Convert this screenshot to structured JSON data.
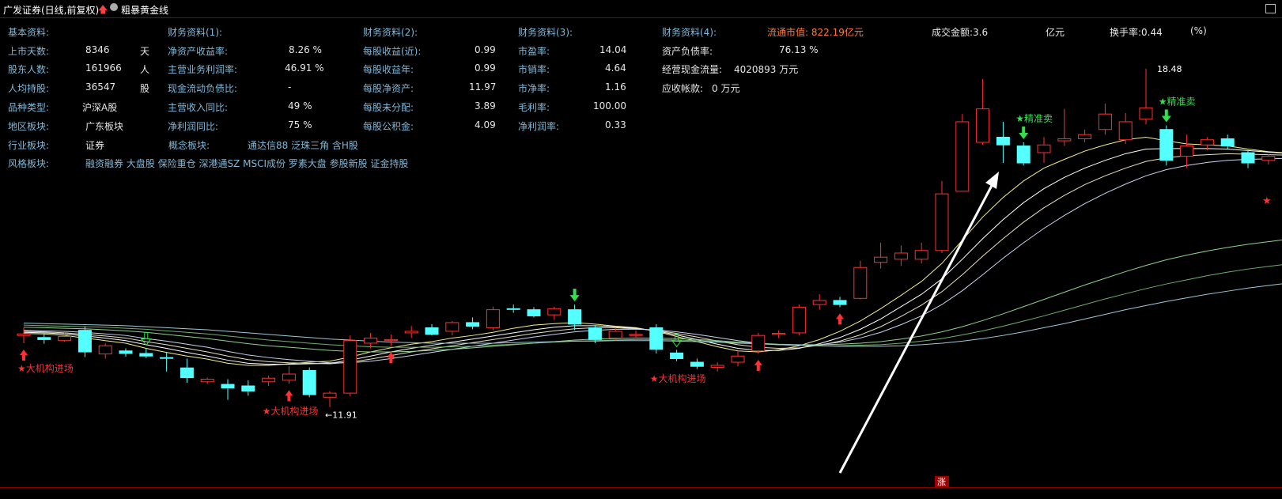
{
  "header": {
    "stock_title": "广发证券(日线,前复权)",
    "indicator_name": "粗暴黄金线",
    "window_icon": "window-restore-icon"
  },
  "fundamentals": {
    "basic": {
      "title": "基本资料:",
      "rows": [
        {
          "label": "上市天数:",
          "value": "8346",
          "unit": "天"
        },
        {
          "label": "股东人数:",
          "value": "161966",
          "unit": "人"
        },
        {
          "label": "人均持股:",
          "value": "36547",
          "unit": "股"
        },
        {
          "label": "品种类型:",
          "value": "沪深A股",
          "unit": ""
        },
        {
          "label": "地区板块:",
          "value": "广东板块",
          "unit": ""
        },
        {
          "label": "行业板块:",
          "value": "证券",
          "unit": ""
        },
        {
          "label": "风格板块:",
          "value": "融资融券 大盘股 保险重仓 深港通SZ MSCI成份 罗素大盘 参股新股 证金持股",
          "unit": ""
        }
      ],
      "concept_label": "概念板块:",
      "concept_value": "通达信88 泛珠三角 含H股"
    },
    "fin1": {
      "title": "财务资料(1):",
      "rows": [
        {
          "label": "净资产收益率:",
          "value": "8.26 %"
        },
        {
          "label": "主营业务利润率:",
          "value": "46.91 %"
        },
        {
          "label": "现金流动负债比:",
          "value": "-"
        },
        {
          "label": "主营收入同比:",
          "value": "49 %"
        },
        {
          "label": "净利润同比:",
          "value": "75 %"
        }
      ]
    },
    "fin2": {
      "title": "财务资料(2):",
      "rows": [
        {
          "label": "每股收益(近):",
          "value": "0.99"
        },
        {
          "label": "每股收益年:",
          "value": "0.99"
        },
        {
          "label": "每股净资产:",
          "value": "11.97"
        },
        {
          "label": "每股未分配:",
          "value": "3.89"
        },
        {
          "label": "每股公积金:",
          "value": "4.09"
        }
      ]
    },
    "fin3": {
      "title": "财务资料(3):",
      "rows": [
        {
          "label": "市盈率:",
          "value": "14.04"
        },
        {
          "label": "市销率:",
          "value": "4.64"
        },
        {
          "label": "市净率:",
          "value": "1.16"
        },
        {
          "label": "毛利率:",
          "value": "100.00"
        },
        {
          "label": "净利润率:",
          "value": "0.33"
        }
      ]
    },
    "fin4": {
      "title": "财务资料(4):",
      "float_mcap": "流通市值: 822.19亿元",
      "rows": [
        {
          "label": "资产负债率:",
          "value": "76.13 %"
        },
        {
          "label": "经营现金流量:",
          "value": "4020893 万元"
        },
        {
          "label": "应收帐款:",
          "value": "0 万元"
        }
      ]
    },
    "turnover": {
      "amount_label": "成交金额:3.6",
      "amount_unit": "亿元",
      "rate_label": "换手率:0.44",
      "rate_unit": "(%)"
    }
  },
  "annotations": {
    "institution_in": "★大机构进场",
    "precise_sell": "★精准卖",
    "low_price": "←11.91",
    "high_price": "18.48",
    "limit_up": "涨"
  },
  "bottom_status": "",
  "colors": {
    "up": "#ff3030",
    "down": "#54ffff",
    "label": "#7fb8d9",
    "signal_sell": "#31e04b",
    "signal_buy": "#ff3030",
    "arrow": "#ffffff"
  },
  "chart_data": {
    "type": "candlestick",
    "ylim": [
      10.6,
      19.2
    ],
    "low_price_marker": 11.91,
    "high_price_marker": 18.48,
    "candles": [
      {
        "o": 13.3,
        "h": 13.45,
        "l": 13.15,
        "c": 13.33
      },
      {
        "o": 13.26,
        "h": 13.34,
        "l": 13.14,
        "c": 13.22
      },
      {
        "o": 13.2,
        "h": 13.38,
        "l": 13.18,
        "c": 13.28
      },
      {
        "o": 13.4,
        "h": 13.48,
        "l": 12.88,
        "c": 12.98
      },
      {
        "o": 12.94,
        "h": 13.15,
        "l": 12.85,
        "c": 13.1
      },
      {
        "o": 13.0,
        "h": 13.05,
        "l": 12.89,
        "c": 12.95
      },
      {
        "o": 12.95,
        "h": 13.05,
        "l": 12.86,
        "c": 12.9
      },
      {
        "o": 12.87,
        "h": 12.98,
        "l": 12.6,
        "c": 12.86
      },
      {
        "o": 12.67,
        "h": 12.85,
        "l": 12.38,
        "c": 12.48
      },
      {
        "o": 12.4,
        "h": 12.48,
        "l": 12.36,
        "c": 12.45
      },
      {
        "o": 12.35,
        "h": 12.45,
        "l": 12.05,
        "c": 12.28
      },
      {
        "o": 12.32,
        "h": 12.43,
        "l": 12.13,
        "c": 12.22
      },
      {
        "o": 12.4,
        "h": 12.52,
        "l": 12.32,
        "c": 12.47
      },
      {
        "o": 12.43,
        "h": 12.7,
        "l": 12.36,
        "c": 12.55
      },
      {
        "o": 12.62,
        "h": 12.68,
        "l": 12.1,
        "c": 12.15
      },
      {
        "o": 12.1,
        "h": 12.22,
        "l": 11.91,
        "c": 12.18
      },
      {
        "o": 12.18,
        "h": 13.3,
        "l": 12.12,
        "c": 13.2
      },
      {
        "o": 13.15,
        "h": 13.35,
        "l": 13.05,
        "c": 13.25
      },
      {
        "o": 13.2,
        "h": 13.32,
        "l": 13.1,
        "c": 13.22
      },
      {
        "o": 13.35,
        "h": 13.48,
        "l": 13.25,
        "c": 13.38
      },
      {
        "o": 13.45,
        "h": 13.52,
        "l": 13.3,
        "c": 13.32
      },
      {
        "o": 13.38,
        "h": 13.58,
        "l": 13.3,
        "c": 13.55
      },
      {
        "o": 13.55,
        "h": 13.65,
        "l": 13.42,
        "c": 13.48
      },
      {
        "o": 13.45,
        "h": 13.86,
        "l": 13.4,
        "c": 13.8
      },
      {
        "o": 13.82,
        "h": 13.9,
        "l": 13.74,
        "c": 13.81
      },
      {
        "o": 13.8,
        "h": 13.85,
        "l": 13.65,
        "c": 13.68
      },
      {
        "o": 13.7,
        "h": 13.86,
        "l": 13.6,
        "c": 13.82
      },
      {
        "o": 13.8,
        "h": 13.9,
        "l": 13.4,
        "c": 13.52
      },
      {
        "o": 13.45,
        "h": 13.5,
        "l": 13.15,
        "c": 13.22
      },
      {
        "o": 13.25,
        "h": 13.45,
        "l": 13.2,
        "c": 13.38
      },
      {
        "o": 13.3,
        "h": 13.4,
        "l": 13.25,
        "c": 13.32
      },
      {
        "o": 13.45,
        "h": 13.52,
        "l": 12.95,
        "c": 13.03
      },
      {
        "o": 12.96,
        "h": 13.02,
        "l": 12.8,
        "c": 12.85
      },
      {
        "o": 12.78,
        "h": 12.85,
        "l": 12.65,
        "c": 12.7
      },
      {
        "o": 12.68,
        "h": 12.78,
        "l": 12.6,
        "c": 12.72
      },
      {
        "o": 12.78,
        "h": 13.0,
        "l": 12.7,
        "c": 12.9
      },
      {
        "o": 13.0,
        "h": 13.35,
        "l": 12.95,
        "c": 13.3
      },
      {
        "o": 13.32,
        "h": 13.4,
        "l": 13.25,
        "c": 13.34
      },
      {
        "o": 13.35,
        "h": 13.9,
        "l": 13.3,
        "c": 13.85
      },
      {
        "o": 13.9,
        "h": 14.1,
        "l": 13.8,
        "c": 13.98
      },
      {
        "o": 13.98,
        "h": 14.05,
        "l": 13.85,
        "c": 13.9
      },
      {
        "o": 14.02,
        "h": 14.75,
        "l": 14.0,
        "c": 14.62
      },
      {
        "o": 14.72,
        "h": 15.1,
        "l": 14.6,
        "c": 14.82
      },
      {
        "o": 14.78,
        "h": 15.05,
        "l": 14.65,
        "c": 14.9
      },
      {
        "o": 14.78,
        "h": 15.1,
        "l": 14.7,
        "c": 14.95
      },
      {
        "o": 14.95,
        "h": 16.3,
        "l": 14.9,
        "c": 16.05
      },
      {
        "o": 16.1,
        "h": 17.6,
        "l": 16.1,
        "c": 17.45
      },
      {
        "o": 17.05,
        "h": 18.28,
        "l": 17.0,
        "c": 17.7
      },
      {
        "o": 17.15,
        "h": 17.45,
        "l": 16.65,
        "c": 17.0
      },
      {
        "o": 16.98,
        "h": 17.05,
        "l": 16.6,
        "c": 16.65
      },
      {
        "o": 16.85,
        "h": 17.15,
        "l": 16.65,
        "c": 17.0
      },
      {
        "o": 17.08,
        "h": 17.7,
        "l": 16.98,
        "c": 17.12
      },
      {
        "o": 17.12,
        "h": 17.3,
        "l": 17.05,
        "c": 17.2
      },
      {
        "o": 17.3,
        "h": 17.8,
        "l": 17.2,
        "c": 17.6
      },
      {
        "o": 17.1,
        "h": 17.62,
        "l": 17.02,
        "c": 17.45
      },
      {
        "o": 17.5,
        "h": 18.48,
        "l": 17.4,
        "c": 17.72
      },
      {
        "o": 17.3,
        "h": 17.38,
        "l": 16.6,
        "c": 16.7
      },
      {
        "o": 16.78,
        "h": 17.2,
        "l": 16.55,
        "c": 16.98
      },
      {
        "o": 17.0,
        "h": 17.15,
        "l": 16.9,
        "c": 17.1
      },
      {
        "o": 17.12,
        "h": 17.2,
        "l": 16.92,
        "c": 16.98
      },
      {
        "o": 16.85,
        "h": 16.9,
        "l": 16.55,
        "c": 16.65
      },
      {
        "o": 16.7,
        "h": 16.82,
        "l": 16.62,
        "c": 16.78
      },
      {
        "o": 16.9,
        "h": 17.1,
        "l": 16.55,
        "c": 16.75
      }
    ],
    "ma_bundle_short": [
      [
        13.34,
        13.33,
        13.3,
        13.25,
        13.2,
        13.15,
        13.05,
        12.97,
        12.9,
        12.84,
        12.76,
        12.72,
        12.72,
        12.75,
        12.78,
        12.8,
        12.88,
        12.98,
        13.06,
        13.13,
        13.18,
        13.25,
        13.3,
        13.36,
        13.44,
        13.5,
        13.53,
        13.55,
        13.52,
        13.48,
        13.45,
        13.38,
        13.28,
        13.18,
        13.08,
        13.0,
        12.98,
        13.02,
        13.1,
        13.22,
        13.38,
        13.58,
        13.82,
        14.08,
        14.35,
        14.7,
        15.15,
        15.6,
        15.98,
        16.3,
        16.55,
        16.72,
        16.88,
        17.0,
        17.1,
        17.15,
        17.08,
        17.02,
        17.0,
        16.98,
        16.92,
        16.87,
        16.84
      ],
      [
        13.36,
        13.35,
        13.33,
        13.29,
        13.25,
        13.2,
        13.12,
        13.05,
        12.97,
        12.9,
        12.82,
        12.76,
        12.74,
        12.74,
        12.75,
        12.76,
        12.82,
        12.9,
        12.98,
        13.05,
        13.11,
        13.17,
        13.23,
        13.29,
        13.35,
        13.41,
        13.46,
        13.49,
        13.49,
        13.47,
        13.44,
        13.39,
        13.31,
        13.22,
        13.13,
        13.05,
        13.01,
        13.01,
        13.05,
        13.14,
        13.26,
        13.42,
        13.62,
        13.86,
        14.1,
        14.4,
        14.78,
        15.18,
        15.55,
        15.88,
        16.15,
        16.37,
        16.55,
        16.7,
        16.83,
        16.92,
        16.93,
        16.93,
        16.93,
        16.92,
        16.89,
        16.86,
        16.83
      ],
      [
        13.38,
        13.37,
        13.35,
        13.32,
        13.29,
        13.25,
        13.18,
        13.12,
        13.05,
        12.98,
        12.9,
        12.83,
        12.79,
        12.77,
        12.76,
        12.75,
        12.78,
        12.84,
        12.91,
        12.98,
        13.04,
        13.1,
        13.16,
        13.22,
        13.28,
        13.34,
        13.39,
        13.43,
        13.45,
        13.45,
        13.43,
        13.4,
        13.34,
        13.27,
        13.19,
        13.12,
        13.07,
        13.05,
        13.06,
        13.11,
        13.19,
        13.31,
        13.47,
        13.67,
        13.89,
        14.15,
        14.48,
        14.84,
        15.18,
        15.5,
        15.78,
        16.02,
        16.23,
        16.4,
        16.55,
        16.68,
        16.75,
        16.79,
        16.81,
        16.83,
        16.82,
        16.81,
        16.8
      ],
      [
        13.4,
        13.39,
        13.38,
        13.36,
        13.33,
        13.3,
        13.24,
        13.19,
        13.13,
        13.07,
        12.99,
        12.92,
        12.87,
        12.83,
        12.8,
        12.77,
        12.77,
        12.8,
        12.85,
        12.91,
        12.97,
        13.03,
        13.09,
        13.15,
        13.21,
        13.27,
        13.32,
        13.37,
        13.4,
        13.42,
        13.42,
        13.41,
        13.37,
        13.32,
        13.26,
        13.2,
        13.15,
        13.12,
        13.11,
        13.12,
        13.17,
        13.25,
        13.36,
        13.51,
        13.68,
        13.9,
        14.17,
        14.48,
        14.8,
        15.1,
        15.38,
        15.63,
        15.86,
        16.06,
        16.24,
        16.4,
        16.52,
        16.6,
        16.66,
        16.7,
        16.72,
        16.73,
        16.74
      ]
    ],
    "ma_bundle_long": [
      [
        13.46,
        13.45,
        13.44,
        13.43,
        13.41,
        13.39,
        13.36,
        13.32,
        13.28,
        13.24,
        13.19,
        13.14,
        13.1,
        13.07,
        13.04,
        13.01,
        12.99,
        12.98,
        12.98,
        12.99,
        13.01,
        13.03,
        13.06,
        13.09,
        13.12,
        13.15,
        13.18,
        13.21,
        13.23,
        13.24,
        13.25,
        13.25,
        13.24,
        13.22,
        13.2,
        13.17,
        13.15,
        13.13,
        13.12,
        13.12,
        13.13,
        13.15,
        13.18,
        13.23,
        13.29,
        13.37,
        13.47,
        13.59,
        13.72,
        13.86,
        14.0,
        14.14,
        14.28,
        14.41,
        14.54,
        14.66,
        14.77,
        14.86,
        14.94,
        15.01,
        15.07,
        15.12,
        15.17
      ],
      [
        13.5,
        13.49,
        13.48,
        13.47,
        13.46,
        13.44,
        13.42,
        13.39,
        13.36,
        13.33,
        13.29,
        13.25,
        13.21,
        13.18,
        13.15,
        13.12,
        13.1,
        13.08,
        13.07,
        13.07,
        13.07,
        13.08,
        13.09,
        13.11,
        13.13,
        13.15,
        13.17,
        13.19,
        13.2,
        13.21,
        13.22,
        13.22,
        13.21,
        13.2,
        13.18,
        13.16,
        13.14,
        13.12,
        13.11,
        13.1,
        13.1,
        13.11,
        13.12,
        13.15,
        13.19,
        13.24,
        13.31,
        13.39,
        13.48,
        13.58,
        13.68,
        13.79,
        13.9,
        14.01,
        14.11,
        14.21,
        14.3,
        14.38,
        14.46,
        14.53,
        14.59,
        14.64,
        14.69
      ],
      [
        13.54,
        13.53,
        13.52,
        13.51,
        13.5,
        13.49,
        13.47,
        13.45,
        13.43,
        13.41,
        13.38,
        13.35,
        13.32,
        13.29,
        13.26,
        13.23,
        13.21,
        13.19,
        13.17,
        13.16,
        13.15,
        13.15,
        13.15,
        13.15,
        13.16,
        13.17,
        13.18,
        13.19,
        13.19,
        13.2,
        13.2,
        13.2,
        13.19,
        13.18,
        13.17,
        13.15,
        13.14,
        13.12,
        13.11,
        13.1,
        13.09,
        13.09,
        13.09,
        13.1,
        13.12,
        13.15,
        13.19,
        13.24,
        13.3,
        13.37,
        13.45,
        13.53,
        13.62,
        13.71,
        13.8,
        13.88,
        13.96,
        14.03,
        14.1,
        14.16,
        14.22,
        14.27,
        14.32
      ]
    ],
    "signals": [
      {
        "i": 0,
        "type": "buy_arrow"
      },
      {
        "i": 6,
        "type": "sell_arrow_hollow"
      },
      {
        "i": 13,
        "type": "buy_arrow"
      },
      {
        "i": 18,
        "type": "buy_arrow"
      },
      {
        "i": 27,
        "type": "sell_arrow"
      },
      {
        "i": 32,
        "type": "sell_arrow_hollow"
      },
      {
        "i": 36,
        "type": "buy_arrow"
      },
      {
        "i": 40,
        "type": "buy_arrow"
      },
      {
        "i": 49,
        "type": "sell_arrow"
      },
      {
        "i": 56,
        "type": "sell_arrow"
      }
    ],
    "labels": [
      {
        "i": 0,
        "text_key": "institution_in",
        "pos": "below"
      },
      {
        "i": 12,
        "text_key": "institution_in",
        "pos": "below"
      },
      {
        "i": 31,
        "text_key": "institution_in",
        "pos": "below"
      },
      {
        "i": 49,
        "text_key": "precise_sell",
        "pos": "above"
      },
      {
        "i": 56,
        "text_key": "precise_sell",
        "pos": "above"
      }
    ]
  }
}
